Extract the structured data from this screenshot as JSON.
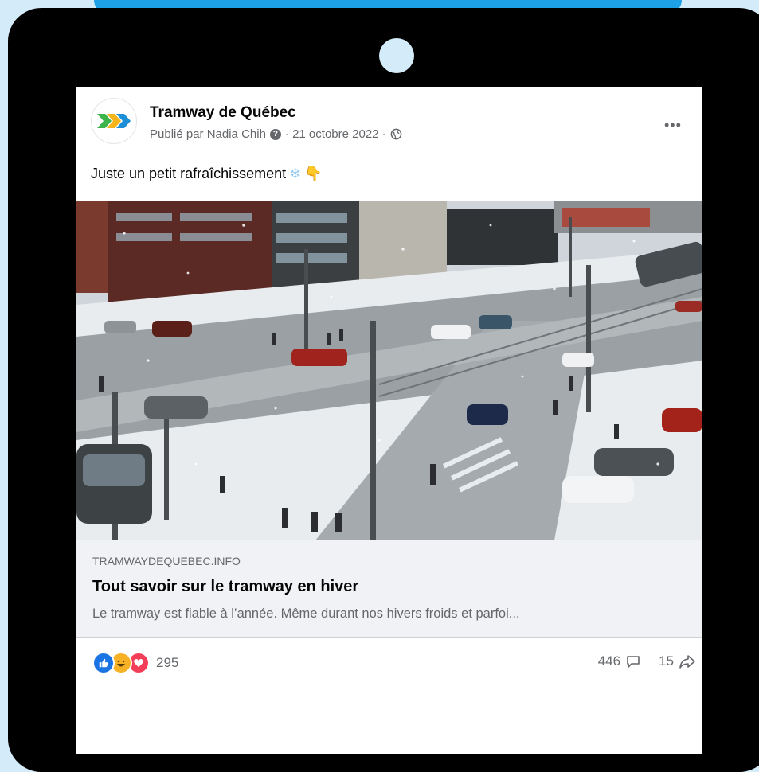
{
  "post": {
    "page_name": "Tramway de Québec",
    "published_by": "Publié par Nadia Chih",
    "date": "· 21 octobre 2022 ·",
    "text": "Juste un petit rafraîchissement",
    "icons": {
      "avatar": "tramway-logo-chevrons",
      "help": "question-circle-icon",
      "audience": "globe-icon",
      "more": "more-horizontal-icon",
      "snowflake": "snowflake-emoji",
      "pointing": "pointing-down-emoji"
    }
  },
  "link_preview": {
    "domain": "TRAMWAYDEQUEBEC.INFO",
    "title": "Tout savoir sur le tramway en hiver",
    "description": "Le tramway est fiable à l’année. Même durant nos hivers froids et parfoi..."
  },
  "engagement": {
    "reaction_count": "295",
    "comment_count": "446",
    "share_count": "15",
    "reaction_icons": [
      "like-icon",
      "haha-icon",
      "love-icon"
    ]
  },
  "colors": {
    "background": "#d4ebf9",
    "top_band": "#1ea0e6",
    "tablet_frame": "#000000",
    "like_blue": "#1b74e4",
    "haha_yellow": "#f7b125",
    "love_red": "#f33e58"
  }
}
